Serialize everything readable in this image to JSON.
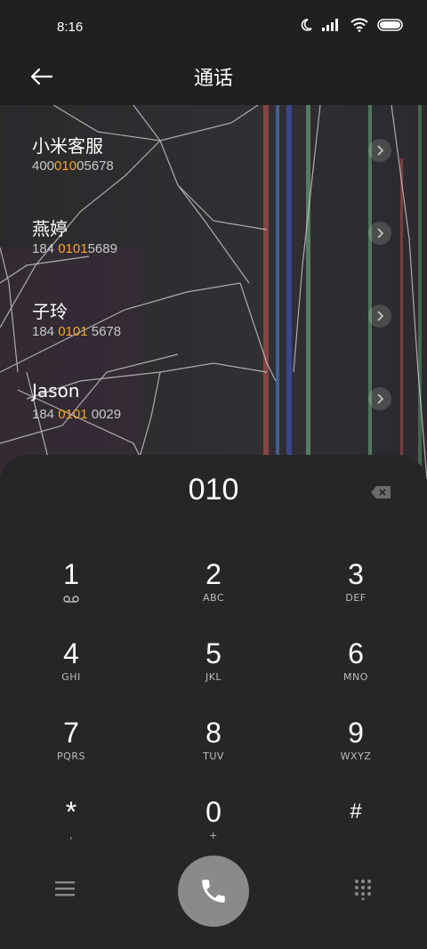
{
  "status": {
    "time": "8:16"
  },
  "header": {
    "title": "通话"
  },
  "contacts": [
    {
      "name": "小米客服",
      "num_pre": "400",
      "num_hl": "010",
      "num_post": "05678"
    },
    {
      "name": "燕婷",
      "num_pre": "184 ",
      "num_hl": "0101",
      "num_post": "5689"
    },
    {
      "name": "子玲",
      "num_pre": "184 ",
      "num_hl": "0101",
      "num_post": " 5678"
    },
    {
      "name": "Jason",
      "num_pre": "184 ",
      "num_hl": "0101",
      "num_post": " 0029"
    }
  ],
  "dialer": {
    "input": "010",
    "keys": [
      {
        "d": "1",
        "l": "⌀⌀"
      },
      {
        "d": "2",
        "l": "ABC"
      },
      {
        "d": "3",
        "l": "DEF"
      },
      {
        "d": "4",
        "l": "GHI"
      },
      {
        "d": "5",
        "l": "JKL"
      },
      {
        "d": "6",
        "l": "MNO"
      },
      {
        "d": "7",
        "l": "PQRS"
      },
      {
        "d": "8",
        "l": "TUV"
      },
      {
        "d": "9",
        "l": "WXYZ"
      },
      {
        "d": "*",
        "l": ","
      },
      {
        "d": "0",
        "l": "+"
      },
      {
        "d": "#",
        "l": ""
      }
    ]
  },
  "colors": {
    "highlight": "#f5a623",
    "call_button": "#8a8a8a"
  }
}
